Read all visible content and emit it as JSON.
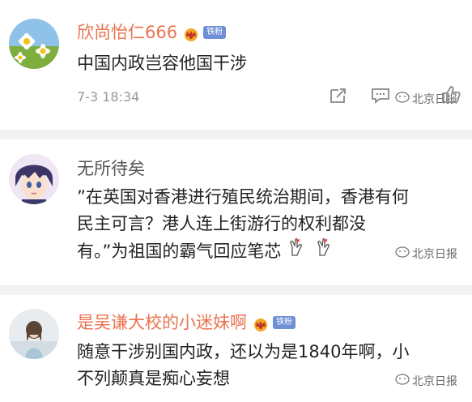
{
  "comments": [
    {
      "username": "欣尚怡仁666",
      "fan_badge": "铁粉",
      "text": "中国内政岂容他国干涉",
      "time": "7-3 18:34",
      "watermark": "北京日报"
    },
    {
      "username": "无所待矣",
      "text_lines": [
        "”在英国对香港进行殖民统治期间，香港有何",
        "民主可言？港人连上街游行的权利都没",
        "有。”为祖国的霸气回应笔芯"
      ],
      "watermark": "北京日报"
    },
    {
      "username": "是吴谦大校的小迷妹啊",
      "fan_badge": "铁粉",
      "text_lines": [
        "随意干涉别国内政，还以为是1840年啊，小",
        "不列颠真是痴心妄想"
      ],
      "watermark": "北京日报"
    }
  ],
  "icons": [
    "daisy-avatar",
    "anime-avatar",
    "photo-avatar",
    "crown-icon",
    "share-icon",
    "comment-icon",
    "like-icon",
    "hand-heart-icon",
    "watermark-logo-icon"
  ],
  "colors": {
    "username_highlight": "#eb7350",
    "badge": "#6f8fd6",
    "meta_grey": "#999999"
  }
}
